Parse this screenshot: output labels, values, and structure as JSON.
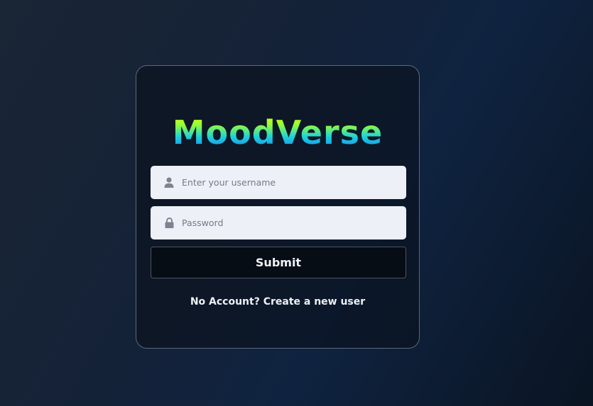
{
  "brand": {
    "logo_text": "MoodVerse"
  },
  "form": {
    "username_placeholder": "Enter your username",
    "username_value": "",
    "username_icon": "user-icon",
    "password_placeholder": "Password",
    "password_value": "",
    "password_icon": "lock-icon",
    "submit_label": "Submit"
  },
  "footer": {
    "signup_link": "No Account? Create a new user"
  },
  "colors": {
    "background": "#142238",
    "card_border": "#5c6878",
    "input_background": "#edf1f7",
    "button_background": "#070d14",
    "logo_gradient": [
      "#f5ff1a",
      "#9bff2e",
      "#1dd3d8",
      "#1a6cff"
    ]
  }
}
